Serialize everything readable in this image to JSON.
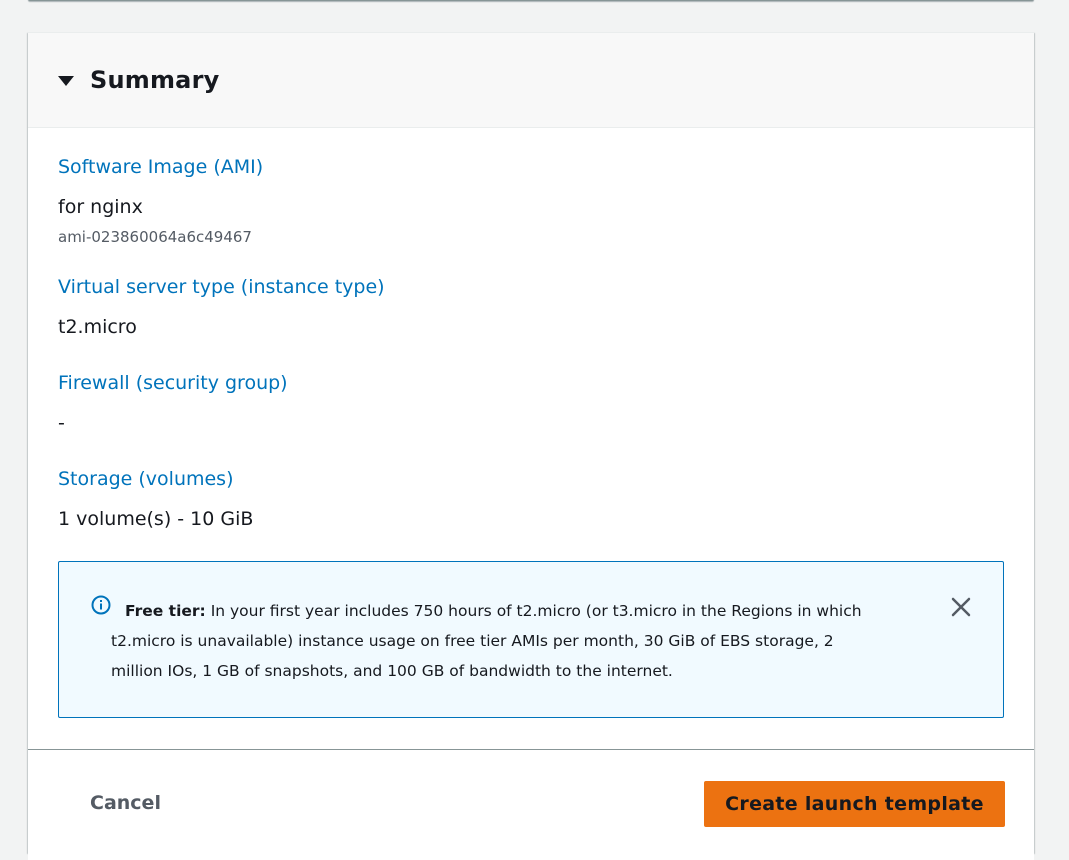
{
  "summary": {
    "title": "Summary",
    "sections": [
      {
        "label": "Software Image (AMI)",
        "value": "for nginx",
        "sub_value": "ami-023860064a6c49467"
      },
      {
        "label": "Virtual server type (instance type)",
        "value": "t2.micro"
      },
      {
        "label": "Firewall (security group)",
        "value": "-"
      },
      {
        "label": "Storage (volumes)",
        "value": "1 volume(s) - 10 GiB"
      }
    ],
    "alert": {
      "title": "Free tier:",
      "lines": [
        "In your first year includes 750 hours of t2.micro (or t3.micro in the Regions in which",
        "t2.micro is unavailable) instance usage on free tier AMIs per month, 30 GiB of EBS storage, 2",
        "million IOs, 1 GB of snapshots, and 100 GB of bandwidth to the internet."
      ],
      "icon": "info-icon",
      "dismiss_icon": "close-icon"
    }
  },
  "footer": {
    "cancel_label": "Cancel",
    "create_label": "Create launch template"
  },
  "colors": {
    "link": "#0073bb",
    "primary_button": "#ec7211",
    "alert_background": "#f1faff",
    "alert_border": "#0073bb"
  }
}
